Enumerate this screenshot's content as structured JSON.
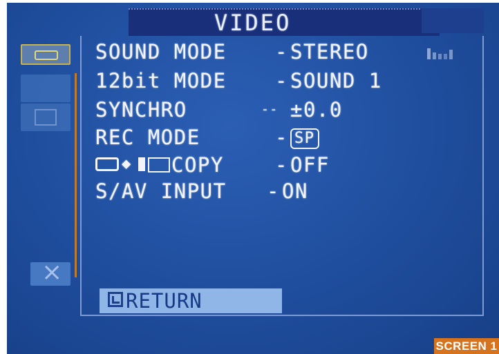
{
  "screen": {
    "title": "VIDEO",
    "return_label": "RETURN",
    "badge": "SCREEN 1"
  },
  "sidebar": {
    "icons": [
      "tape-icon",
      "settings-icon",
      "monitor-icon",
      "close-icon"
    ]
  },
  "menu": {
    "rows": [
      {
        "label": "SOUND MODE",
        "dash": "-",
        "value": "STEREO"
      },
      {
        "label": "12bit MODE",
        "dash": "-",
        "value": "SOUND 1"
      },
      {
        "label": "SYNCHRO",
        "dash": "--",
        "value": "±0.0"
      },
      {
        "label": "REC MODE",
        "dash": "-",
        "value": "SP"
      },
      {
        "label": "COPY",
        "dash": "-",
        "value": "OFF"
      },
      {
        "label": "S/AV INPUT",
        "dash": "-",
        "value": "ON"
      }
    ]
  },
  "colors": {
    "screen_blue": "#1f4d9d",
    "highlight": "#8fb6e6",
    "badge": "#d5731e"
  }
}
